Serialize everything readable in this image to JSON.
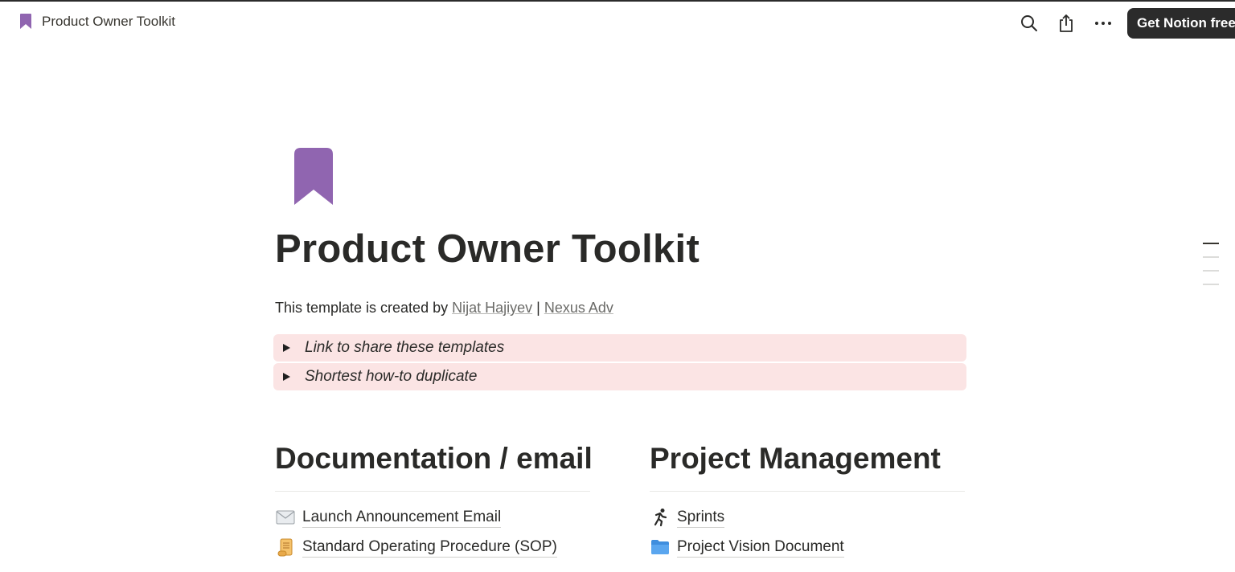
{
  "topbar": {
    "breadcrumb_title": "Product Owner Toolkit",
    "get_notion_label": "Get Notion free",
    "icons": [
      "bookmark-icon",
      "search-icon",
      "share-icon",
      "more-icon"
    ]
  },
  "page": {
    "icon": "bookmark-icon",
    "icon_color": "#9065b0",
    "title": "Product Owner Toolkit",
    "byline_prefix": "This template is created by ",
    "author_link": "Nijat Hajiyev",
    "byline_separator": " | ",
    "company_link": "Nexus Adv",
    "toggles": [
      {
        "label": "Link to share these templates"
      },
      {
        "label": "Shortest how-to duplicate"
      }
    ],
    "toggle_bg": "#fbe4e4"
  },
  "columns": [
    {
      "heading": "Documentation / email",
      "links": [
        {
          "icon": "envelope-icon",
          "label": "Launch Announcement Email"
        },
        {
          "icon": "scroll-icon",
          "label": "Standard Operating Procedure (SOP)"
        }
      ]
    },
    {
      "heading": "Project Management",
      "links": [
        {
          "icon": "runner-icon",
          "label": "Sprints"
        },
        {
          "icon": "folder-icon",
          "label": "Project Vision Document"
        }
      ]
    }
  ]
}
